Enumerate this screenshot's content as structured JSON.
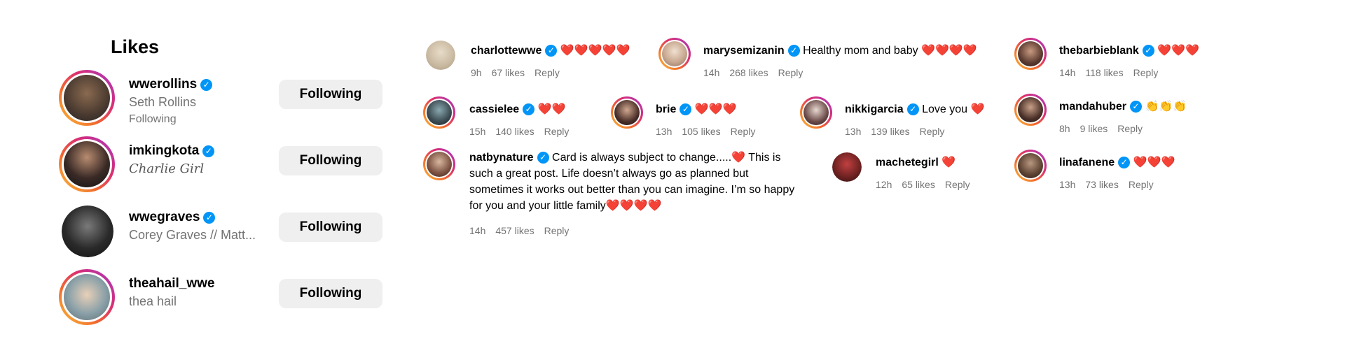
{
  "likes": {
    "title": "Likes",
    "items": [
      {
        "username": "wwerollins",
        "full_name": "Seth Rollins",
        "status": "Following",
        "button": "Following"
      },
      {
        "username": "imkingkota",
        "full_name": "Charlie Girl",
        "button": "Following"
      },
      {
        "username": "wwegraves",
        "full_name": "Corey Graves // Matt...",
        "button": "Following"
      },
      {
        "username": "theahail_wwe",
        "full_name": "thea hail",
        "button": "Following"
      }
    ]
  },
  "comments": [
    {
      "username": "charlottewwe",
      "text": "❤️❤️❤️❤️❤️",
      "time": "9h",
      "likes": "67 likes",
      "reply": "Reply"
    },
    {
      "username": "marysemizanin",
      "text": "Healthy mom and baby ❤️❤️❤️❤️",
      "time": "14h",
      "likes": "268 likes",
      "reply": "Reply"
    },
    {
      "username": "thebarbieblank",
      "text": "❤️❤️❤️",
      "time": "14h",
      "likes": "118 likes",
      "reply": "Reply"
    },
    {
      "username": "cassielee",
      "text": "❤️❤️",
      "time": "15h",
      "likes": "140 likes",
      "reply": "Reply"
    },
    {
      "username": "brie",
      "text": "❤️❤️❤️",
      "time": "13h",
      "likes": "105 likes",
      "reply": "Reply"
    },
    {
      "username": "nikkigarcia",
      "text": "Love you ❤️",
      "time": "13h",
      "likes": "139 likes",
      "reply": "Reply"
    },
    {
      "username": "mandahuber",
      "text": "👏👏👏",
      "time": "8h",
      "likes": "9 likes",
      "reply": "Reply"
    },
    {
      "username": "natbynature",
      "text": "Card is always subject to change.....❤️ This is such a great post. Life doesn’t always go as planned but sometimes it works out better than you can imagine. I’m so happy for you and your little family❤️❤️❤️❤️",
      "time": "14h",
      "likes": "457 likes",
      "reply": "Reply"
    },
    {
      "username": "machetegirl",
      "text": "❤️",
      "time": "12h",
      "likes": "65 likes",
      "reply": "Reply"
    },
    {
      "username": "linafanene",
      "text": "❤️❤️❤️",
      "time": "13h",
      "likes": "73 likes",
      "reply": "Reply"
    }
  ],
  "icons": {
    "verified": "verified-badge-icon"
  },
  "colors": {
    "verified": "#0095f6",
    "button_bg": "#efefef",
    "muted_text": "#737373",
    "heart": "#ed2d56"
  }
}
